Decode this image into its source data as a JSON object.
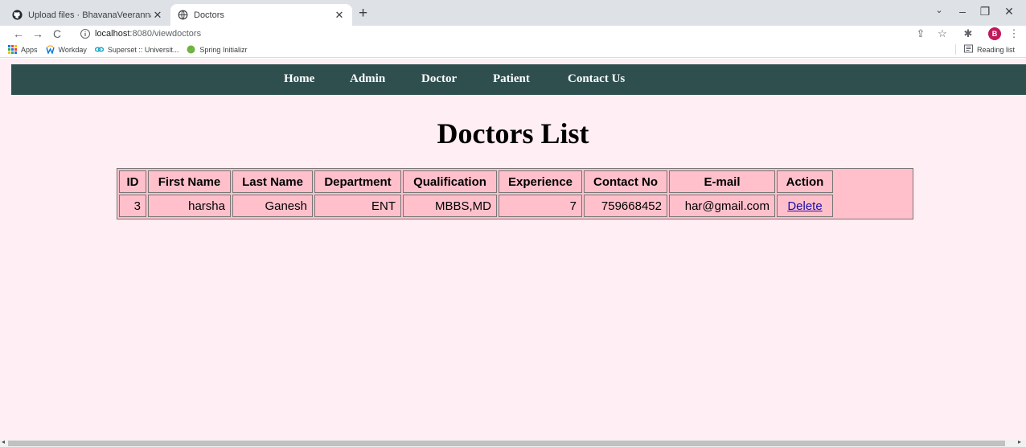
{
  "browser": {
    "tabs": [
      {
        "title": "Upload files · BhavanaVeeranna/",
        "close": "✕",
        "icon": "github-icon"
      },
      {
        "title": "Doctors",
        "close": "✕",
        "icon": "globe-icon"
      }
    ],
    "new_tab": "+",
    "url_host": "localhost",
    "url_path": ":8080/viewdoctors",
    "bookmarks": [
      {
        "label": "Apps",
        "icon": "apps-grid-icon"
      },
      {
        "label": "Workday",
        "icon": "workday-icon"
      },
      {
        "label": "Superset :: Universit...",
        "icon": "superset-icon"
      },
      {
        "label": "Spring Initializr",
        "icon": "spring-icon"
      }
    ],
    "reading_list": "Reading list",
    "profile_initial": "B"
  },
  "navbar": {
    "links": [
      "Home",
      "Admin",
      "Doctor",
      "Patient",
      "Contact Us"
    ],
    "background": "#2f4f4f"
  },
  "page": {
    "title": "Doctors List",
    "background": "#ffeef3"
  },
  "table": {
    "headers": [
      "ID",
      "First Name",
      "Last Name",
      "Department",
      "Qualification",
      "Experience",
      "Contact No",
      "E-mail",
      "Action"
    ],
    "rows": [
      {
        "id": "3",
        "first_name": "harsha",
        "last_name": "Ganesh",
        "department": "ENT",
        "qualification": "MBBS,MD",
        "experience": "7",
        "contact_no": "759668452",
        "email": "har@gmail.com",
        "action": "Delete"
      }
    ],
    "background": "#ffc0cb"
  }
}
